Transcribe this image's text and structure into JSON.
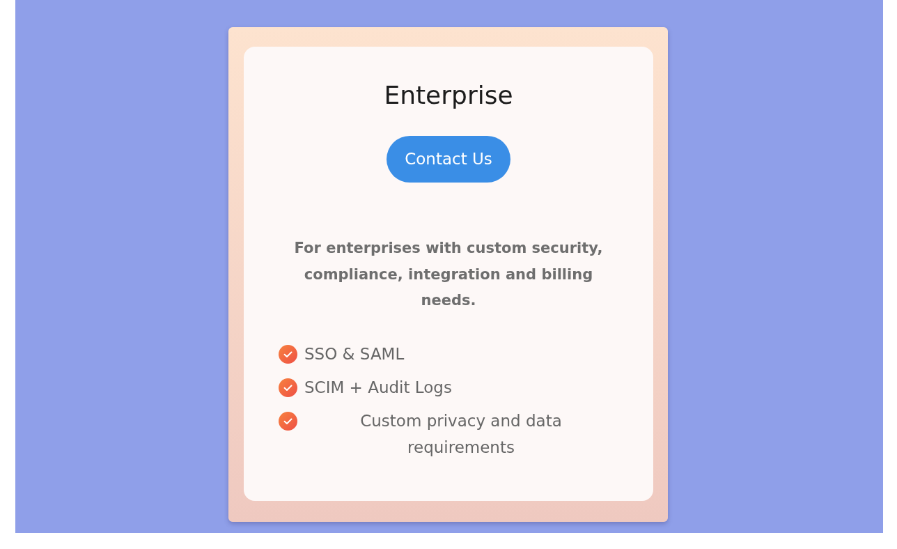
{
  "plan": {
    "title": "Enterprise",
    "button": {
      "label": "Contact Us"
    },
    "description": "For enterprises with custom security, compliance, integration and billing needs.",
    "features": [
      {
        "label": "SSO & SAML"
      },
      {
        "label": "SCIM + Audit Logs"
      },
      {
        "label": "Custom privacy and data requirements"
      }
    ]
  }
}
